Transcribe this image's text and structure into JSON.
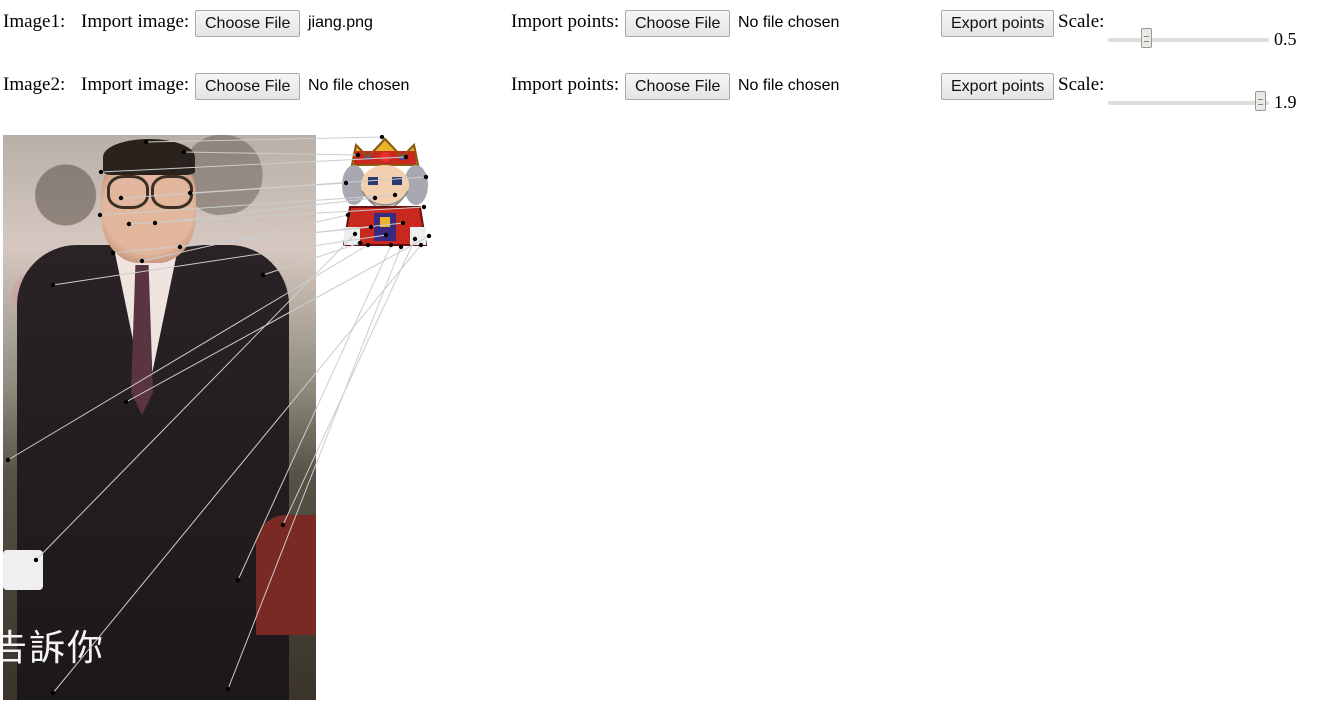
{
  "rows": [
    {
      "id": "image1",
      "label": "Image1:",
      "import_image_label": "Import image:",
      "import_image_button": "Choose File",
      "import_image_status": "jiang.png",
      "import_points_label": "Import points:",
      "import_points_button": "Choose File",
      "import_points_status": "No file chosen",
      "export_button": "Export points",
      "scale_label": "Scale:",
      "scale_value": "0.5",
      "scale_fraction": 0.22
    },
    {
      "id": "image2",
      "label": "Image2:",
      "import_image_label": "Import image:",
      "import_image_button": "Choose File",
      "import_image_status": "No file chosen",
      "import_points_label": "Import points:",
      "import_points_button": "Choose File",
      "import_points_status": "No file chosen",
      "export_button": "Export points",
      "scale_label": "Scale:",
      "scale_value": "1.9",
      "scale_fraction": 0.98
    }
  ],
  "canvas": {
    "photo_subtitle": "告訴你",
    "photo_name": "jiang.png",
    "sprite_name": "king-sprite",
    "point_color": "#000000",
    "link_color": "#cccccc"
  }
}
